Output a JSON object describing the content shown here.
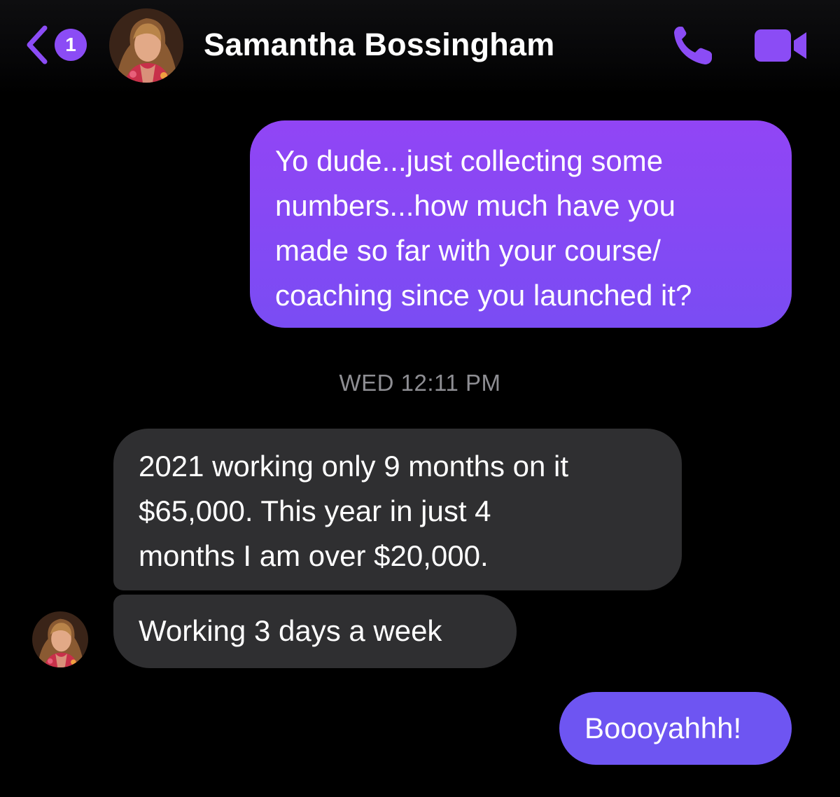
{
  "header": {
    "back_badge_count": "1",
    "contact_name": "Samantha Bossingham",
    "accent_color": "#8b4cf5"
  },
  "icons": {
    "back": "chevron-left-icon",
    "call": "phone-icon",
    "video": "video-camera-icon"
  },
  "messages": [
    {
      "direction": "outgoing",
      "lines": [
        "Yo dude...just collecting some",
        "numbers...how much have you",
        "made so far with your course/",
        "coaching since you launched it?"
      ]
    },
    {
      "type": "timestamp",
      "text": "WED 12:11 PM"
    },
    {
      "direction": "incoming",
      "lines": [
        "2021 working only 9 months on it",
        "$65,000.  This year in just 4",
        "months I am over $20,000."
      ]
    },
    {
      "direction": "incoming",
      "lines": [
        "Working 3 days a week"
      ]
    },
    {
      "direction": "outgoing",
      "lines": [
        "Boooyahhh!"
      ]
    }
  ],
  "colors": {
    "outgoing_bubble": "#8a48f5",
    "incoming_bubble": "#2f2f31",
    "last_outgoing_bubble": "#6e55f2",
    "timestamp_text": "#8e8e93",
    "background": "#000000"
  }
}
